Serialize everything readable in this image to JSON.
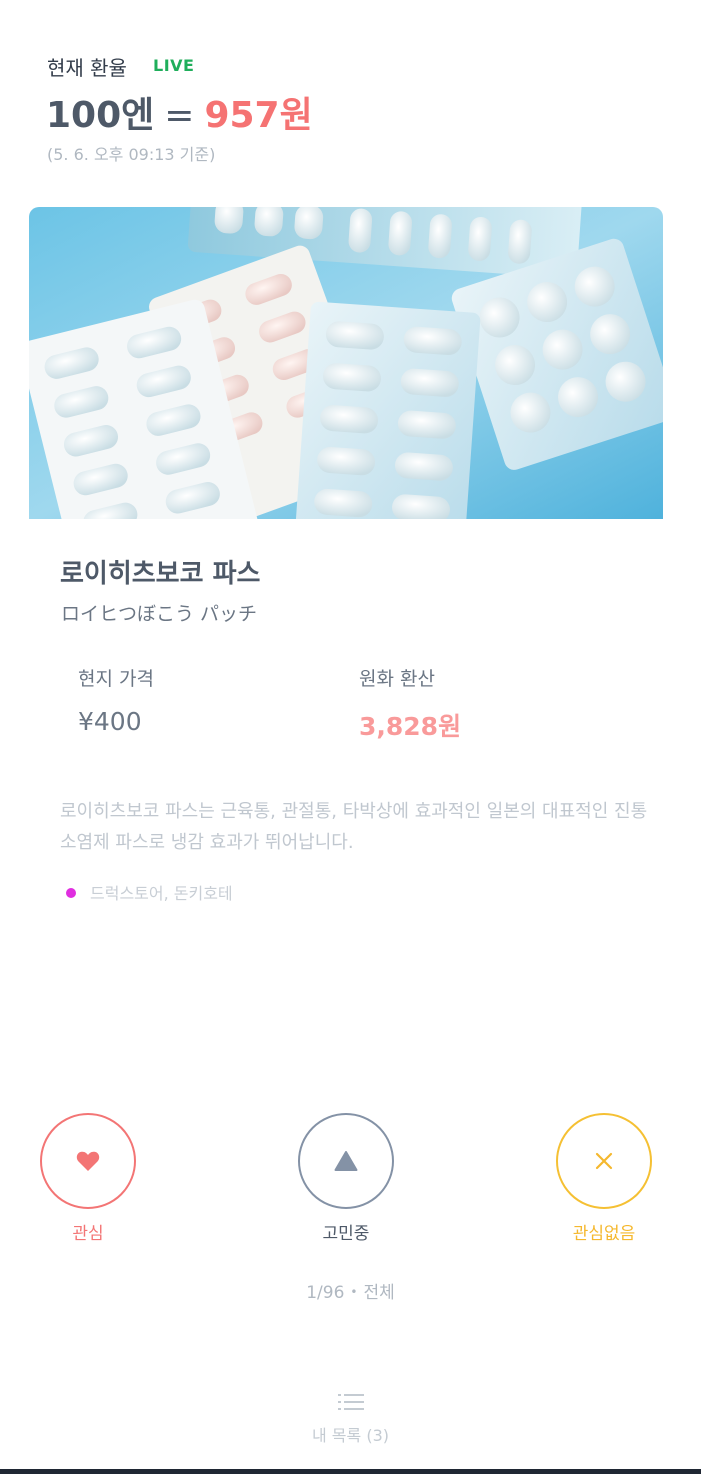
{
  "rate": {
    "label": "현재 환율",
    "live": "LIVE",
    "yen": "100엔",
    "eq": "=",
    "won": "957원",
    "timestamp": "(5. 6. 오후 09:13 기준)"
  },
  "product": {
    "image": "pill-blister-packs-photo",
    "name_ko": "로이히츠보코 파스",
    "name_ja": "ロイヒつぼこう パッチ",
    "local_price_label": "현지 가격",
    "local_price": "¥400",
    "krw_label": "원화 환산",
    "krw_price": "3,828원",
    "description": "로이히츠보코 파스는 근육통, 관절통, 타박상에 효과적인 일본의 대표적인 진통 소염제 파스로 냉감 효과가 뛰어납니다.",
    "stores": "드럭스토어, 돈키호테"
  },
  "actions": {
    "like": {
      "label": "관심",
      "icon": "heart-icon",
      "color": "#f37575"
    },
    "thinking": {
      "label": "고민중",
      "icon": "triangle-icon",
      "color": "#8492a6"
    },
    "not_interested": {
      "label": "관심없음",
      "icon": "close-icon",
      "color": "#f5c033"
    }
  },
  "pager": {
    "position": "1/96",
    "separator": "•",
    "filter": "전체"
  },
  "my_list": {
    "icon": "list-icon",
    "label": "내 목록 (3)"
  }
}
